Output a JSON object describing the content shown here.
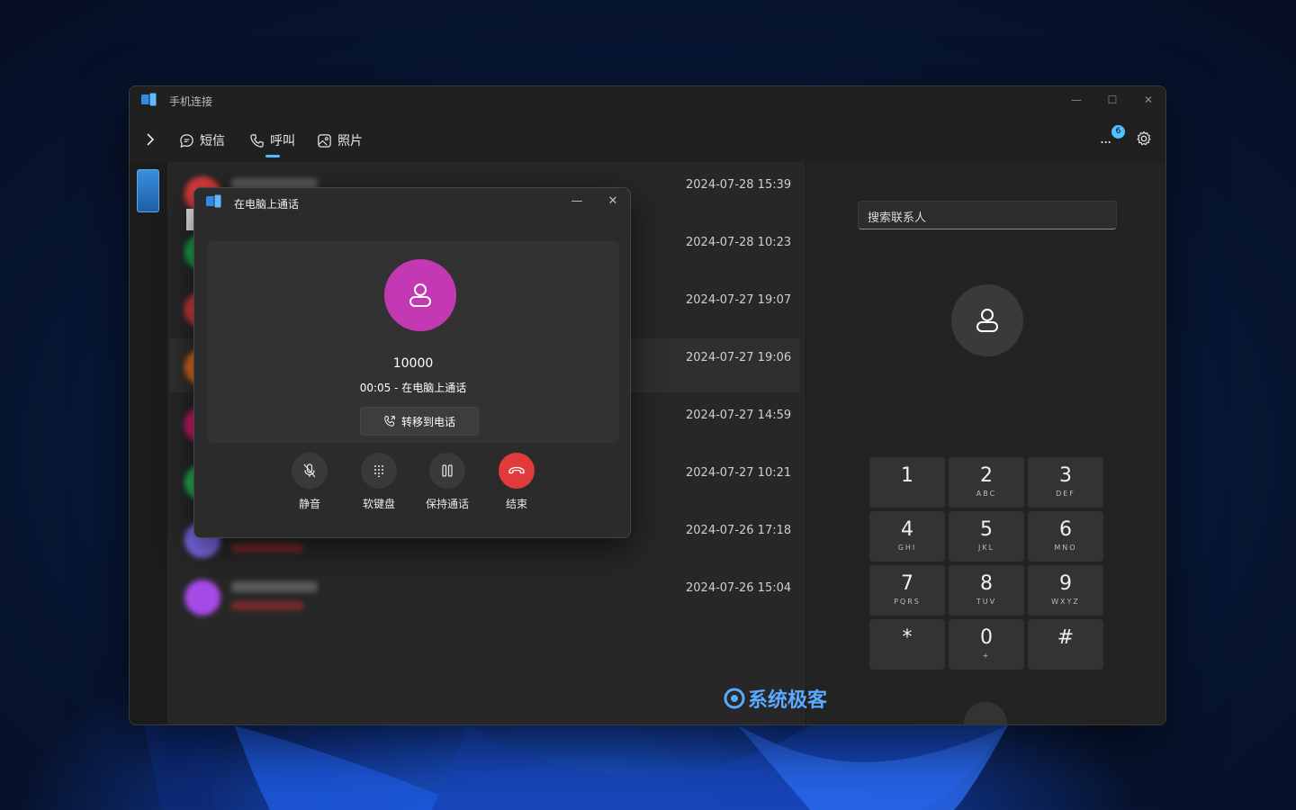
{
  "app": {
    "title": "手机连接",
    "window_controls": {
      "minimize": "—",
      "maximize": "☐",
      "close": "✕"
    }
  },
  "nav": {
    "tabs": [
      {
        "label": "短信",
        "icon": "message-icon"
      },
      {
        "label": "呼叫",
        "icon": "phone-icon",
        "active": true
      },
      {
        "label": "照片",
        "icon": "photo-icon"
      }
    ],
    "more_label": "...",
    "notification_count": "6"
  },
  "calls": [
    {
      "time": "2024-07-28 15:39",
      "color": "#d83b3b"
    },
    {
      "time": "2024-07-28 10:23",
      "color": "#1aa34a"
    },
    {
      "time": "2024-07-27 19:07",
      "color": "#d83b3b"
    },
    {
      "time": "2024-07-27 19:06",
      "color": "#e06a1a",
      "selected": true
    },
    {
      "time": "2024-07-27 14:59",
      "color": "#d0166a"
    },
    {
      "time": "2024-07-27 10:21",
      "color": "#22b04e"
    },
    {
      "time": "2024-07-26 17:18",
      "color": "#7a6ae6"
    },
    {
      "time": "2024-07-26 15:04",
      "color": "#a64ae6"
    }
  ],
  "dialer": {
    "search_placeholder": "搜索联系人",
    "keys": [
      {
        "digit": "1",
        "letters": ""
      },
      {
        "digit": "2",
        "letters": "ABC"
      },
      {
        "digit": "3",
        "letters": "DEF"
      },
      {
        "digit": "4",
        "letters": "GHI"
      },
      {
        "digit": "5",
        "letters": "JKL"
      },
      {
        "digit": "6",
        "letters": "MNO"
      },
      {
        "digit": "7",
        "letters": "PQRS"
      },
      {
        "digit": "8",
        "letters": "TUV"
      },
      {
        "digit": "9",
        "letters": "WXYZ"
      },
      {
        "digit": "*",
        "letters": ""
      },
      {
        "digit": "0",
        "letters": "+"
      },
      {
        "digit": "#",
        "letters": ""
      }
    ]
  },
  "call_dialog": {
    "title": "在电脑上通话",
    "number": "10000",
    "status": "00:05 - 在电脑上通话",
    "transfer_label": "转移到电话",
    "controls": {
      "mute": "静音",
      "keypad": "软键盘",
      "hold": "保持通话",
      "end": "结束"
    },
    "avatar_color": "#c239b3",
    "end_color": "#e03a3a"
  },
  "watermark": "系统极客",
  "colors": {
    "accent": "#4cc2ff"
  }
}
